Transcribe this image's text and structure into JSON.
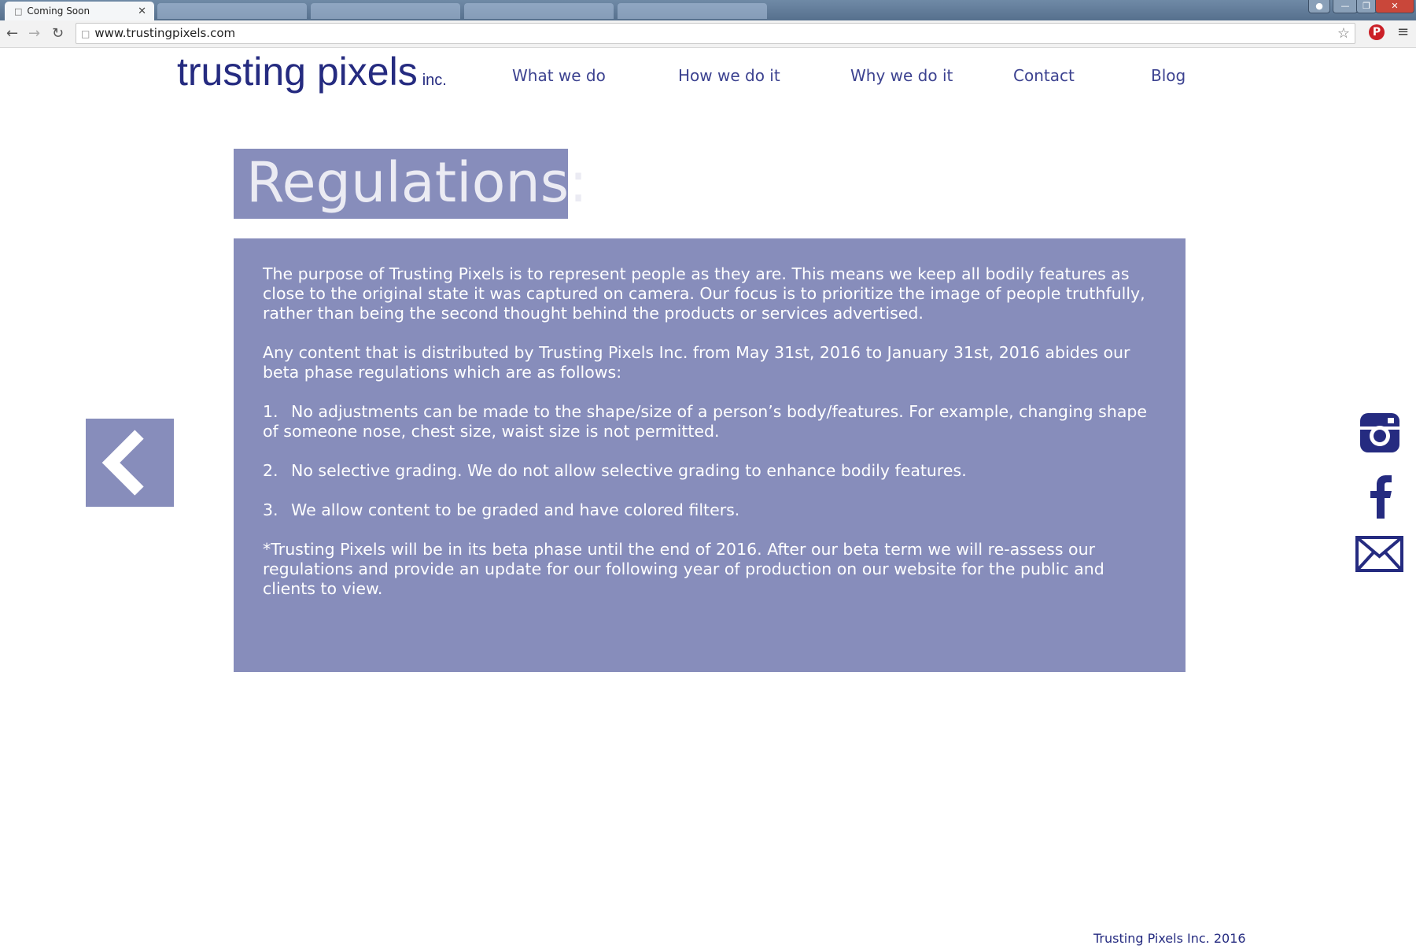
{
  "browser": {
    "active_tab_title": "Coming Soon",
    "url": "www.trustingpixels.com"
  },
  "header": {
    "logo": "trusting pixels",
    "logo_suffix": "inc.",
    "nav": [
      {
        "label": "What we do"
      },
      {
        "label": "How we do it"
      },
      {
        "label": "Why we do it"
      },
      {
        "label": "Contact"
      },
      {
        "label": "Blog"
      }
    ]
  },
  "main": {
    "title": "Regulations:",
    "paragraphs": {
      "intro": "The purpose of Trusting Pixels is to represent people as they are.  This means we keep all bodily features as close to the original state it was captured on camera. Our focus is to prioritize the image of people truthfully, rather than being the second thought behind the products or services advertised.",
      "scope": "Any content that is distributed by Trusting Pixels Inc. from May 31st, 2016 to January 31st, 2016 abides our beta phase regulations which are as follows:",
      "note": "*Trusting Pixels will be in its beta phase until the end of 2016. After our beta term we will re-assess our regulations and provide an update for our following year of production on our website for the public and clients to view."
    },
    "rules": [
      {
        "num": "1.",
        "text": "No adjustments can be made to the shape/size of a person’s body/features. For example, changing shape of someone nose, chest size, waist size is not permitted."
      },
      {
        "num": "2.",
        "text": "No selective grading.  We do not allow selective grading to enhance bodily features."
      },
      {
        "num": "3.",
        "text": "We allow content to be graded and have colored filters."
      }
    ]
  },
  "social": [
    "instagram-icon",
    "facebook-icon",
    "mail-icon"
  ],
  "footer": {
    "text": "Trusting Pixels Inc. 2016"
  },
  "colors": {
    "brand": "#252b80",
    "panel": "#878dbb",
    "nav": "#3c4290"
  }
}
